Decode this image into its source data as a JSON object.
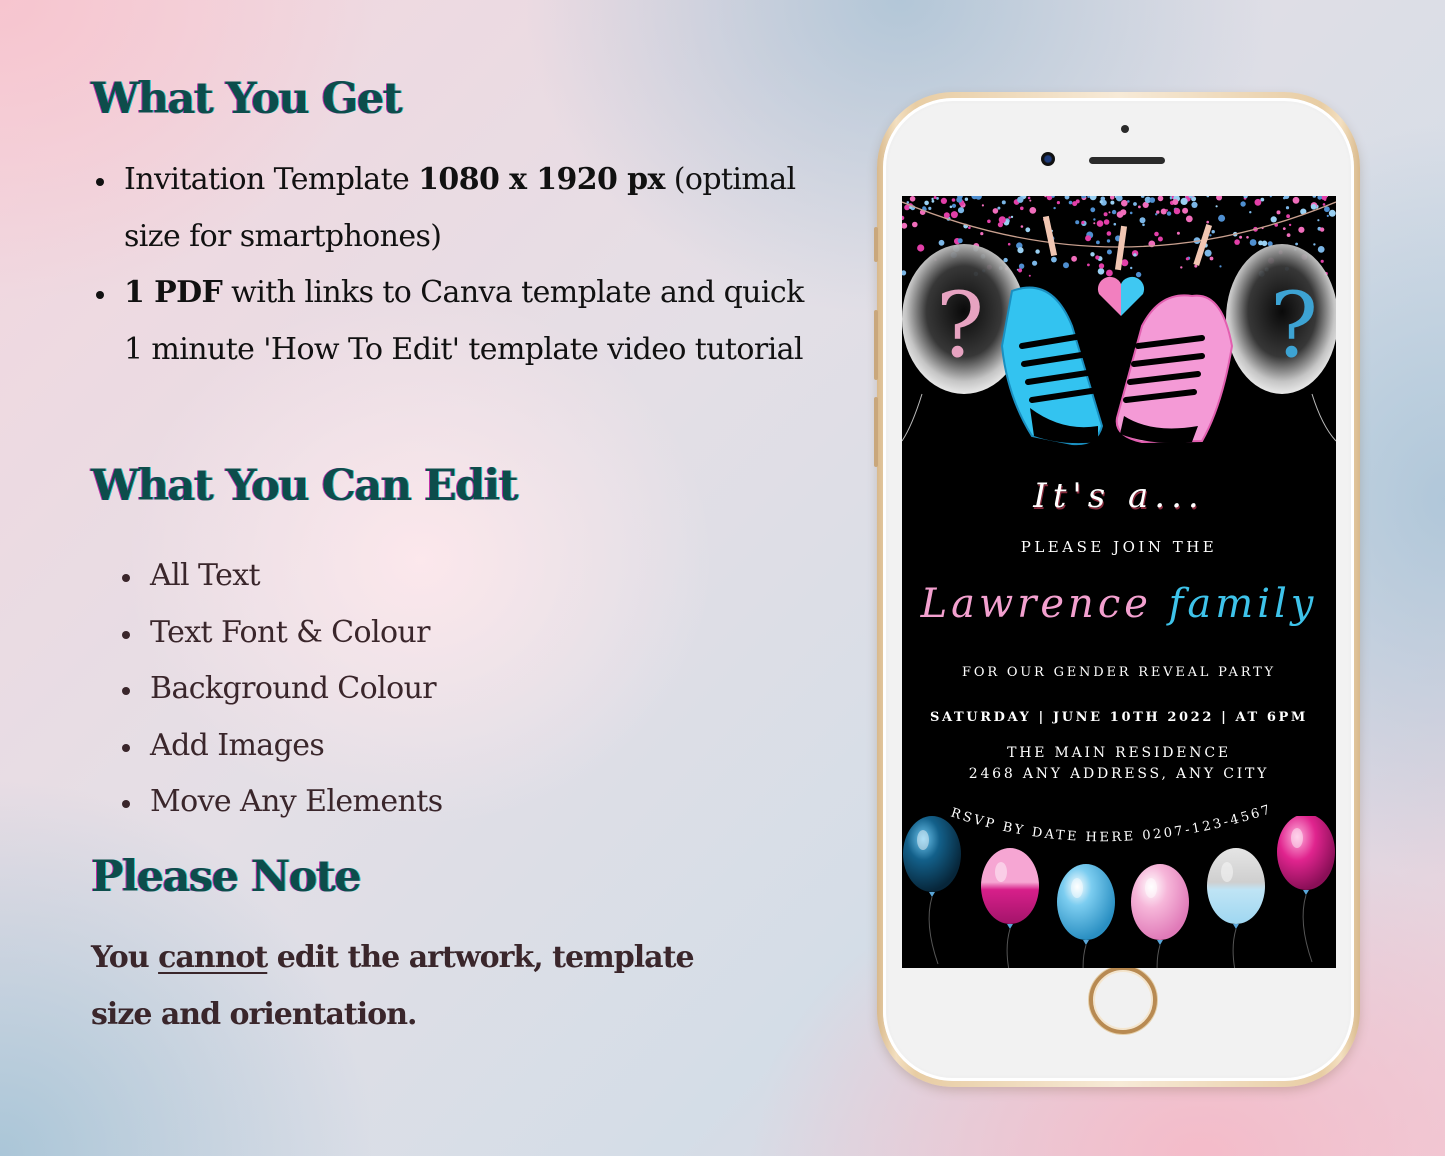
{
  "what_you_get": {
    "heading": "What You Get",
    "items": [
      {
        "pre": "Invitation Template ",
        "bold": "1080 x 1920 px",
        "post": " (optimal size for smartphones)"
      },
      {
        "pre": "",
        "bold": "1 PDF",
        "post": " with links to Canva template and quick 1 minute 'How To Edit' template video tutorial"
      }
    ]
  },
  "what_you_can_edit": {
    "heading": "What You Can Edit",
    "items": [
      "All Text",
      "Text Font & Colour",
      "Background Colour",
      "Add Images",
      "Move Any Elements"
    ]
  },
  "please_note": {
    "heading": "Please Note",
    "pre": "You ",
    "underlined": "cannot",
    "post": " edit the artwork, template size and orientation."
  },
  "invitation": {
    "intro": "It's a...",
    "join": "PLEASE JOIN THE",
    "family_name": "Lawrence",
    "family_word": "family",
    "event": "FOR OUR GENDER REVEAL PARTY",
    "date_line": "SATURDAY | JUNE 10TH 2022 | AT 6PM",
    "venue": "THE MAIN RESIDENCE",
    "address": "2468 ANY ADDRESS, ANY CITY",
    "rsvp": "RSVP BY DATE HERE 0207-123-4567",
    "artwork": {
      "top": [
        "confetti",
        "clothesline",
        "question-balloon-pink",
        "sneaker-blue",
        "heart-pink-blue",
        "sneaker-pink",
        "question-balloon-blue"
      ],
      "bottom_balloons": [
        "navy-blue",
        "pink-glitter-drip",
        "blue-sparkle",
        "pink-glitter",
        "silver-glitter-drip",
        "magenta"
      ]
    }
  },
  "colors": {
    "heading": "#0d4d4b",
    "body_text": "#3a262b",
    "accent_pink": "#f3a0cf",
    "accent_blue": "#3ec3ea",
    "phone_gold": "#c9a77c"
  }
}
